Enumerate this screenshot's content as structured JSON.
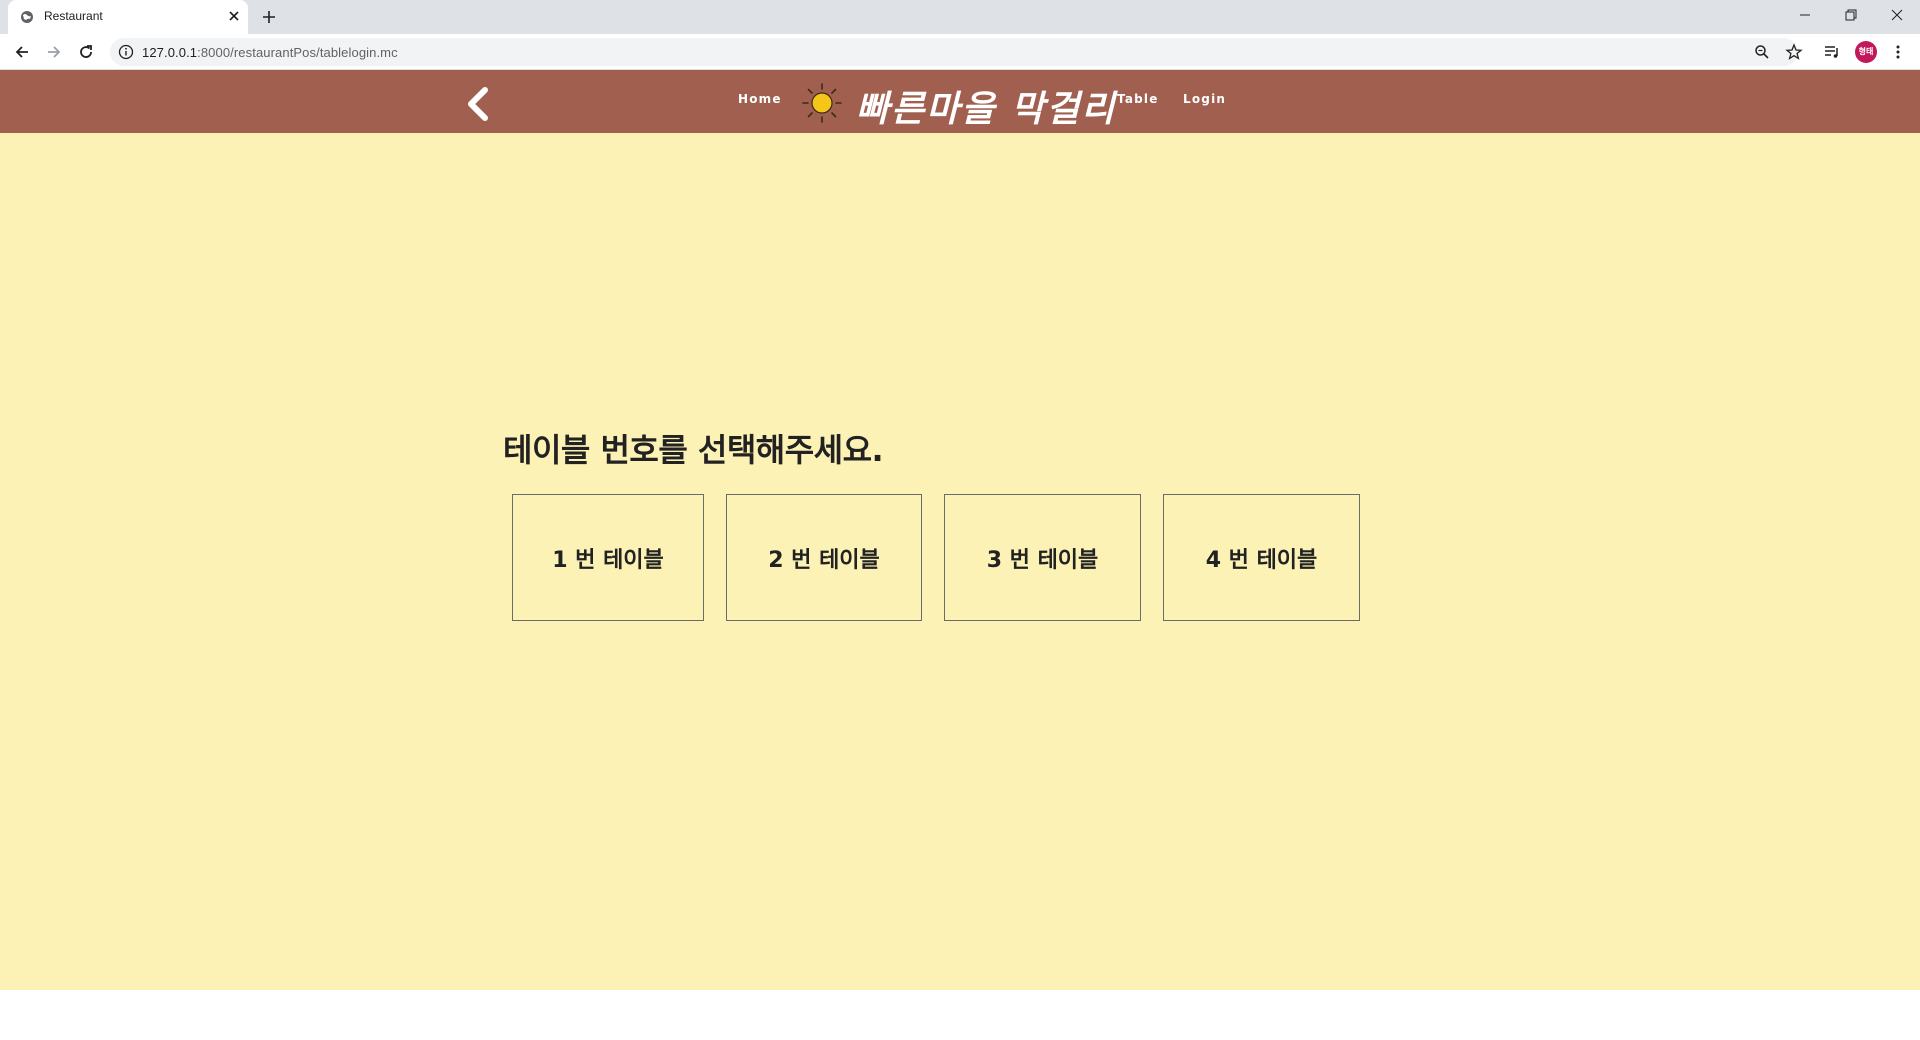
{
  "browser": {
    "tab_title": "Restaurant",
    "url_host": "127.0.0.1",
    "url_rest": ":8000/restaurantPos/tablelogin.mc",
    "profile_initials": "형태"
  },
  "nav": {
    "home_label": "Home",
    "logo_text": "빠른마을 막걸리",
    "table_label": "Table",
    "login_label": "Login"
  },
  "main": {
    "heading": "테이블 번호를 선택해주세요.",
    "tables": [
      {
        "label": "1 번 테이블"
      },
      {
        "label": "2 번 테이블"
      },
      {
        "label": "3 번 테이블"
      },
      {
        "label": "4 번 테이블"
      }
    ]
  },
  "colors": {
    "nav_bg": "#a15f4f",
    "page_bg": "#fdf2b6",
    "sun": "#f5c518"
  },
  "icons": [
    "globe-icon",
    "close-icon",
    "plus-icon",
    "minimize-icon",
    "restore-icon",
    "window-close-icon",
    "back-icon",
    "forward-icon",
    "reload-icon",
    "info-icon",
    "zoom-icon",
    "star-icon",
    "media-icon",
    "menu-icon",
    "chevron-left-icon",
    "sun-icon"
  ]
}
